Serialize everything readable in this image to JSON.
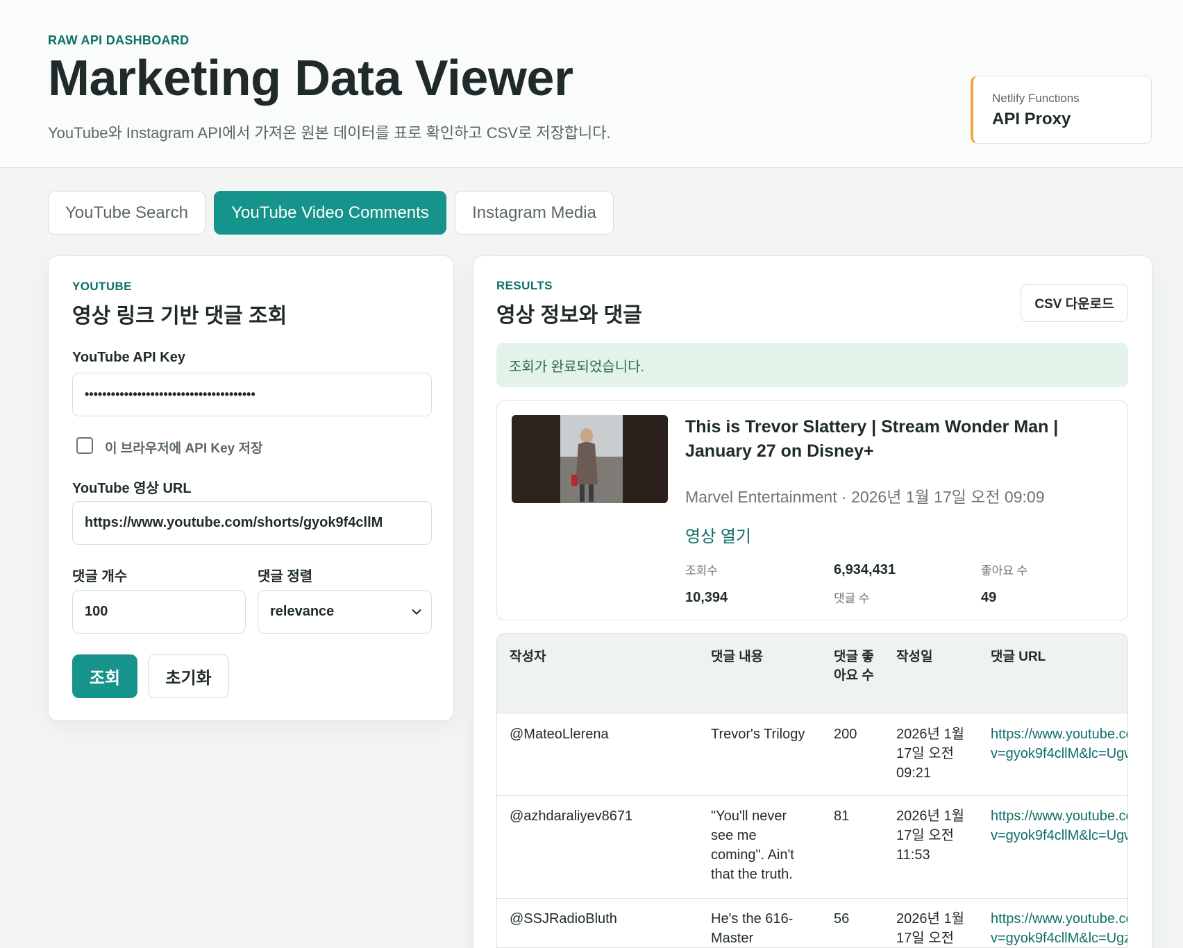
{
  "header": {
    "eyebrow": "RAW API DASHBOARD",
    "title": "Marketing Data Viewer",
    "subtitle": "YouTube와 Instagram API에서 가져온 원본 데이터를 표로 확인하고 CSV로 저장합니다.",
    "proxy_small": "Netlify Functions",
    "proxy_big": "API Proxy"
  },
  "tabs": [
    {
      "label": "YouTube Search",
      "active": false
    },
    {
      "label": "YouTube Video Comments",
      "active": true
    },
    {
      "label": "Instagram Media",
      "active": false
    }
  ],
  "form": {
    "eyebrow": "YOUTUBE",
    "title": "영상 링크 기반 댓글 조회",
    "api_key_label": "YouTube API Key",
    "api_key_value": "•••••••••••••••••••••••••••••••••••••••",
    "save_key_label": "이 브라우저에 API Key 저장",
    "save_key_checked": false,
    "url_label": "YouTube 영상 URL",
    "url_value": "https://www.youtube.com/shorts/gyok9f4cllM",
    "count_label": "댓글 개수",
    "count_value": "100",
    "sort_label": "댓글 정렬",
    "sort_value": "relevance",
    "submit_label": "조회",
    "reset_label": "초기화"
  },
  "results": {
    "eyebrow": "RESULTS",
    "title": "영상 정보와 댓글",
    "csv_label": "CSV 다운로드",
    "status": "조회가 완료되었습니다.",
    "video": {
      "title": "This is Trevor Slattery | Stream Wonder Man | January 27 on Disney+",
      "meta": "Marvel Entertainment · 2026년 1월 17일 오전 09:09",
      "open_link": "영상 열기",
      "views_label": "조회수",
      "views_value": "6,934,431",
      "likes_label": "좋아요 수",
      "likes_value": "10,394",
      "comments_label": "댓글 수",
      "comments_value": "49"
    },
    "table": {
      "headers": [
        "작성자",
        "댓글 내용",
        "댓글 좋아요 수",
        "작성일",
        "댓글 URL"
      ],
      "rows": [
        {
          "author": "@MateoLlerena",
          "text": "Trevor's Trilogy",
          "likes": "200",
          "date": "2026년 1월 17일 오전 09:21",
          "url1": "https://www.youtube.co",
          "url2": "v=gyok9f4cllM&lc=Ugw"
        },
        {
          "author": "@azhdaraliyev8671",
          "text": "\"You'll never see me coming\". Ain't that the truth.",
          "likes": "81",
          "date": "2026년 1월 17일 오전 11:53",
          "url1": "https://www.youtube.co",
          "url2": "v=gyok9f4cllM&lc=Ugw"
        },
        {
          "author": "@SSJRadioBluth",
          "text": "He's the 616-Master",
          "likes": "56",
          "date": "2026년 1월 17일 오전",
          "url1": "https://www.youtube.co",
          "url2": "v=gyok9f4cllM&lc=Ugz"
        }
      ]
    }
  },
  "colors": {
    "accent": "#16938a",
    "accent_text": "#0e6f66",
    "proxy_border": "#f0a53a",
    "status_bg": "#e4f3ea"
  }
}
